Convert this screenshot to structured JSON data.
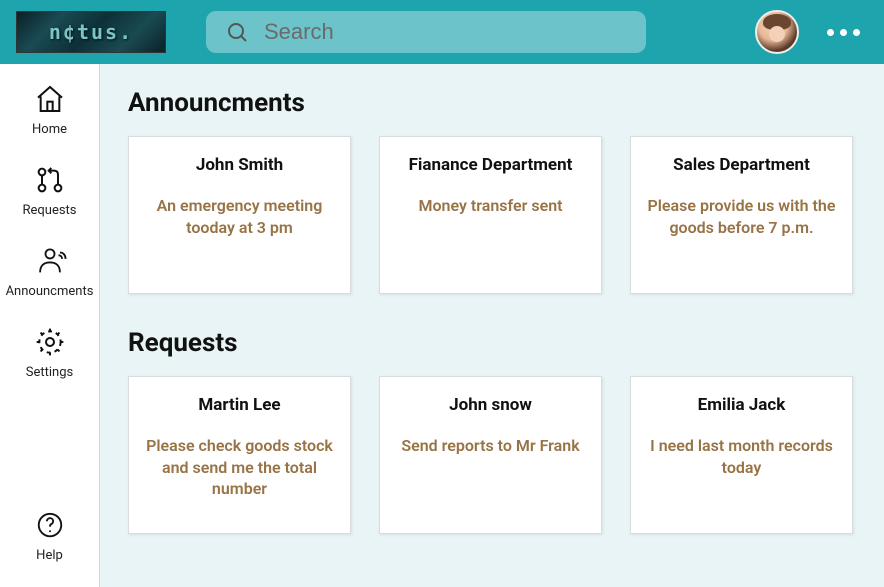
{
  "logo_text": "n¢tus.",
  "search": {
    "placeholder": "Search",
    "value": ""
  },
  "sidebar": {
    "items": [
      {
        "label": "Home"
      },
      {
        "label": "Requests"
      },
      {
        "label": "Announcments"
      },
      {
        "label": "Settings"
      },
      {
        "label": "Help"
      }
    ]
  },
  "sections": {
    "announcements": {
      "title": "Announcments",
      "cards": [
        {
          "title": "John Smith",
          "body": "An emergency meeting tooday at 3 pm"
        },
        {
          "title": "Fianance Department",
          "body": "Money transfer sent"
        },
        {
          "title": "Sales Department",
          "body": "Please provide us with the goods before 7 p.m."
        }
      ]
    },
    "requests": {
      "title": "Requests",
      "cards": [
        {
          "title": "Martin Lee",
          "body": "Please check goods stock and send me the total number"
        },
        {
          "title": "John snow",
          "body": "Send reports to Mr Frank"
        },
        {
          "title": "Emilia Jack",
          "body": "I need last month records today"
        }
      ]
    }
  }
}
